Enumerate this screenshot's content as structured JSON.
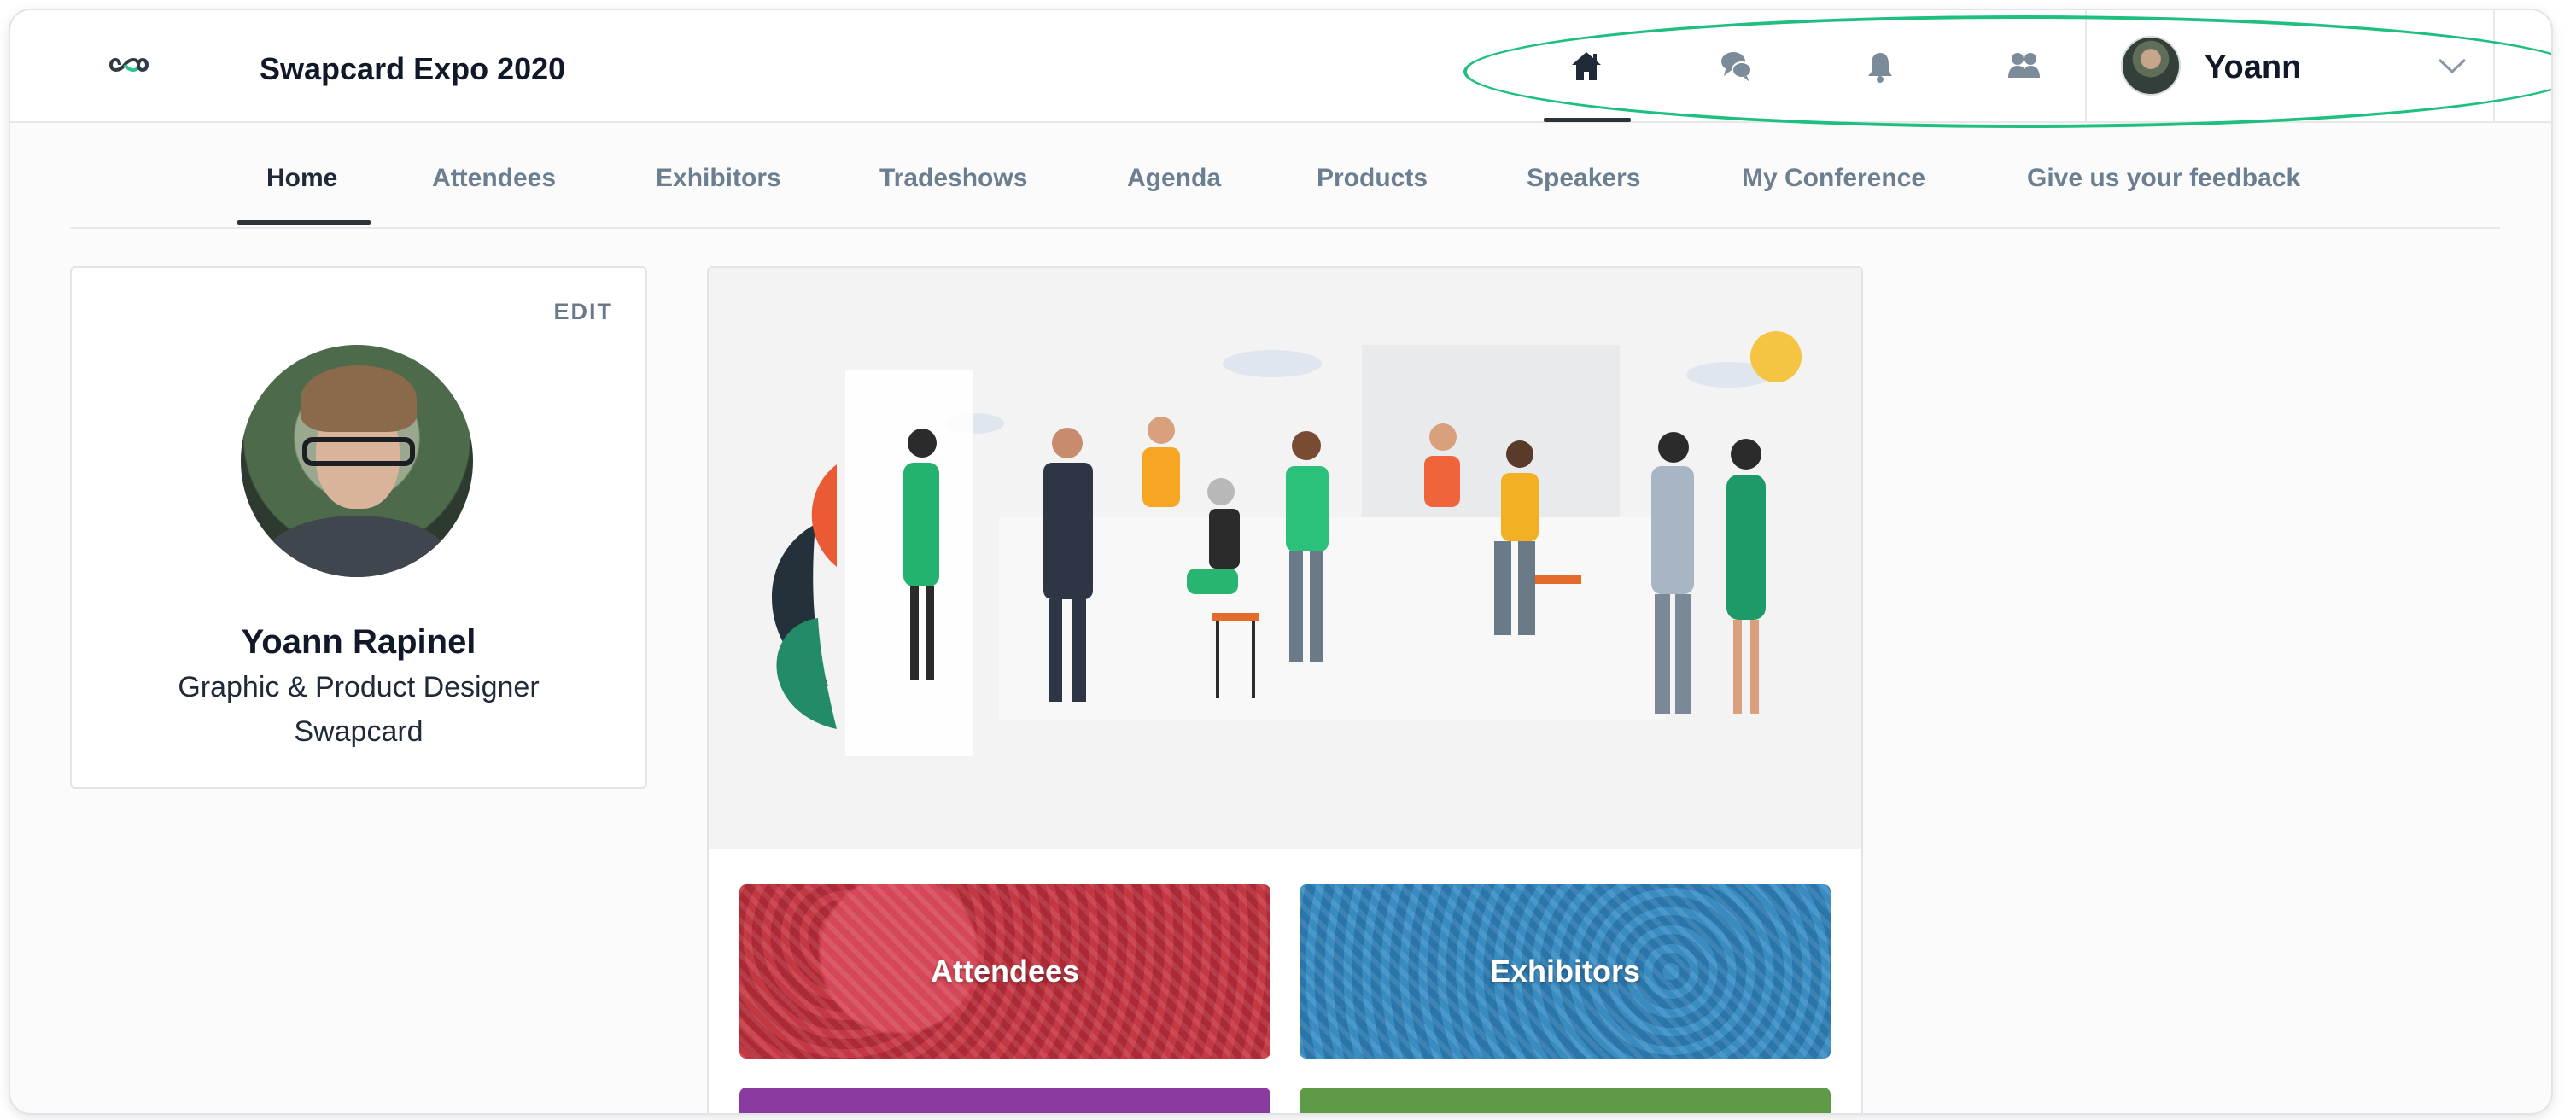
{
  "app": {
    "event_title": "Swapcard Expo 2020",
    "logo_icon": "infinity-logo-icon"
  },
  "topbar": {
    "icons": [
      {
        "name": "home-icon",
        "active": true
      },
      {
        "name": "chat-icon",
        "active": false
      },
      {
        "name": "bell-icon",
        "active": false
      },
      {
        "name": "people-icon",
        "active": false
      }
    ],
    "user": {
      "name": "Yoann",
      "dropdown_icon": "chevron-down-icon"
    }
  },
  "subnav": {
    "tabs": [
      {
        "label": "Home",
        "active": true
      },
      {
        "label": "Attendees",
        "active": false
      },
      {
        "label": "Exhibitors",
        "active": false
      },
      {
        "label": "Tradeshows",
        "active": false
      },
      {
        "label": "Agenda",
        "active": false
      },
      {
        "label": "Products",
        "active": false
      },
      {
        "label": "Speakers",
        "active": false
      },
      {
        "label": "My Conference",
        "active": false
      },
      {
        "label": "Give us your feedback",
        "active": false
      }
    ]
  },
  "profile": {
    "edit_label": "EDIT",
    "name": "Yoann Rapinel",
    "role": "Graphic & Product Designer",
    "company": "Swapcard"
  },
  "tiles": [
    {
      "label": "Attendees",
      "color": "#c73945"
    },
    {
      "label": "Exhibitors",
      "color": "#2b78ae"
    },
    {
      "label": "",
      "color": "#8a3ba0"
    },
    {
      "label": "",
      "color": "#5f9a46"
    }
  ],
  "colors": {
    "highlight_ring": "#1fbf7f",
    "inactive_tab": "#6b7f90",
    "active_text": "#1f2937"
  }
}
